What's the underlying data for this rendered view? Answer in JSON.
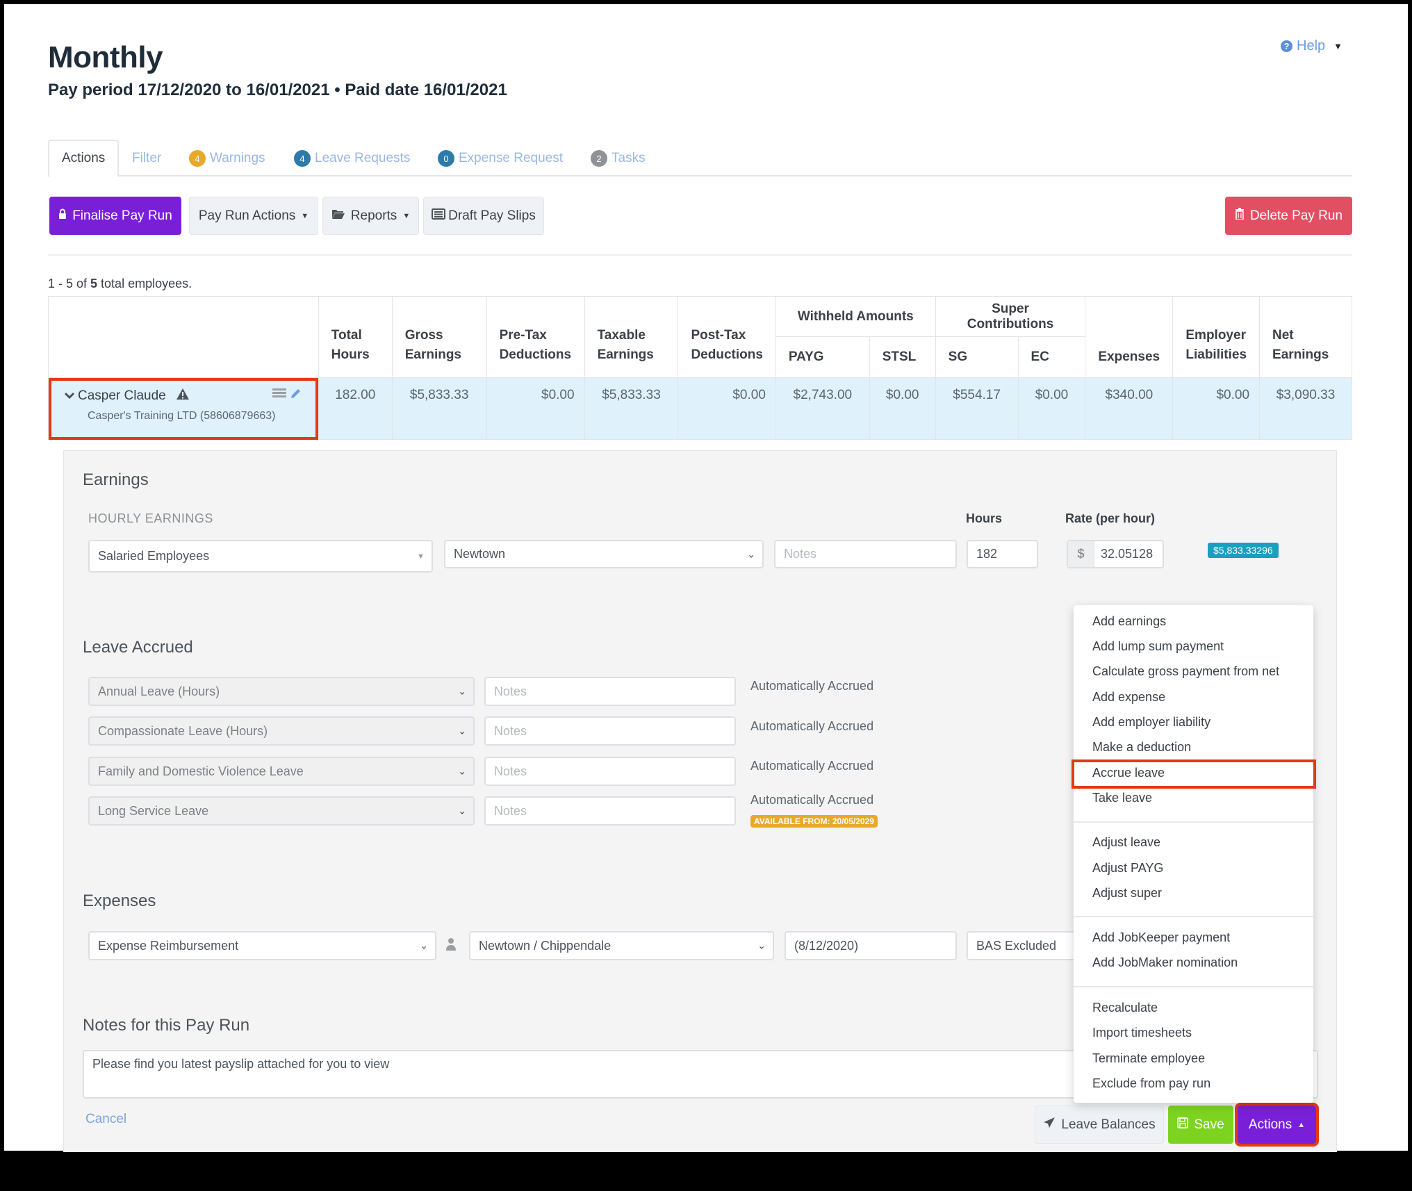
{
  "header": {
    "title": "Monthly",
    "subtitle": "Pay period 17/12/2020 to 16/01/2021 • Paid date 16/01/2021",
    "help_label": "Help",
    "help_icon": "question-circle-icon"
  },
  "tabs": [
    {
      "label": "Actions",
      "active": true
    },
    {
      "label": "Filter"
    },
    {
      "label": "Warnings",
      "badge": "4",
      "badge_color": "#e8a92b"
    },
    {
      "label": "Leave Requests",
      "badge": "4",
      "badge_color": "#2e7aa8"
    },
    {
      "label": "Expense Request",
      "badge": "0",
      "badge_color": "#2e7aa8"
    },
    {
      "label": "Tasks",
      "badge": "2",
      "badge_color": "#8f9398"
    }
  ],
  "toolbar": {
    "finalise": "Finalise Pay Run",
    "pay_run_actions": "Pay Run Actions",
    "reports": "Reports",
    "draft_pay_slips": "Draft Pay Slips",
    "delete": "Delete Pay Run"
  },
  "summary": {
    "prefix": "1 - 5 of ",
    "total": "5",
    "suffix": " total employees."
  },
  "table": {
    "headers": {
      "total_hours": [
        "Total",
        "Hours"
      ],
      "gross": [
        "Gross",
        "Earnings"
      ],
      "pretax": [
        "Pre-Tax",
        "Deductions"
      ],
      "taxable": [
        "Taxable",
        "Earnings"
      ],
      "posttax": [
        "Post-Tax",
        "Deductions"
      ],
      "withheld": "Withheld Amounts",
      "payg": "PAYG",
      "stsl": "STSL",
      "super": "Super Contributions",
      "sg": "SG",
      "ec": "EC",
      "expenses": "Expenses",
      "employer": [
        "Employer",
        "Liabilities"
      ],
      "net": [
        "Net",
        "Earnings"
      ]
    },
    "row": {
      "name": "Casper Claude",
      "company": "Casper's Training LTD (58606879663)",
      "total_hours": "182.00",
      "gross": "$5,833.33",
      "pretax": "$0.00",
      "taxable": "$5,833.33",
      "posttax": "$0.00",
      "payg": "$2,743.00",
      "stsl": "$0.00",
      "sg": "$554.17",
      "ec": "$0.00",
      "expenses": "$340.00",
      "employer": "$0.00",
      "net": "$3,090.33"
    }
  },
  "earnings": {
    "heading": "Earnings",
    "sub": "HOURLY EARNINGS",
    "hours_label": "Hours",
    "rate_label": "Rate (per hour)",
    "category": "Salaried Employees",
    "location": "Newtown",
    "notes_placeholder": "Notes",
    "hours": "182",
    "currency": "$",
    "rate": "32.05128",
    "total_badge": "$5,833.33296"
  },
  "leave": {
    "heading": "Leave Accrued",
    "rows": [
      {
        "type": "Annual Leave (Hours)",
        "notes_placeholder": "Notes",
        "status": "Automatically Accrued"
      },
      {
        "type": "Compassionate Leave (Hours)",
        "notes_placeholder": "Notes",
        "status": "Automatically Accrued"
      },
      {
        "type": "Family and Domestic Violence Leave",
        "notes_placeholder": "Notes",
        "status": "Automatically Accrued"
      },
      {
        "type": "Long Service Leave",
        "notes_placeholder": "Notes",
        "status": "Automatically Accrued",
        "available": "AVAILABLE FROM: 20/05/2029"
      }
    ]
  },
  "expenses": {
    "heading": "Expenses",
    "type": "Expense Reimbursement",
    "location": "Newtown / Chippendale",
    "date": "(8/12/2020)",
    "tax": "BAS Excluded"
  },
  "notes": {
    "heading": "Notes for this Pay Run",
    "value": "Please find you latest payslip attached for you to view",
    "cancel": "Cancel"
  },
  "footer_buttons": {
    "leave_balances": "Leave Balances",
    "save": "Save",
    "actions": "Actions"
  },
  "actions_menu": {
    "groups": [
      [
        "Add earnings",
        "Add lump sum payment",
        "Calculate gross payment from net",
        "Add expense",
        "Add employer liability",
        "Make a deduction",
        "Accrue leave",
        "Take leave"
      ],
      [
        "Adjust leave",
        "Adjust PAYG",
        "Adjust super"
      ],
      [
        "Add JobKeeper payment",
        "Add JobMaker nomination"
      ],
      [
        "Recalculate",
        "Import timesheets",
        "Terminate employee",
        "Exclude from pay run"
      ]
    ],
    "highlighted": "Accrue leave"
  },
  "colors": {
    "primary_purple": "#7a1fd8",
    "danger": "#e24f62",
    "success": "#7ed321",
    "row_highlight": "#dff1fa",
    "annotation_red": "#e23a12"
  }
}
